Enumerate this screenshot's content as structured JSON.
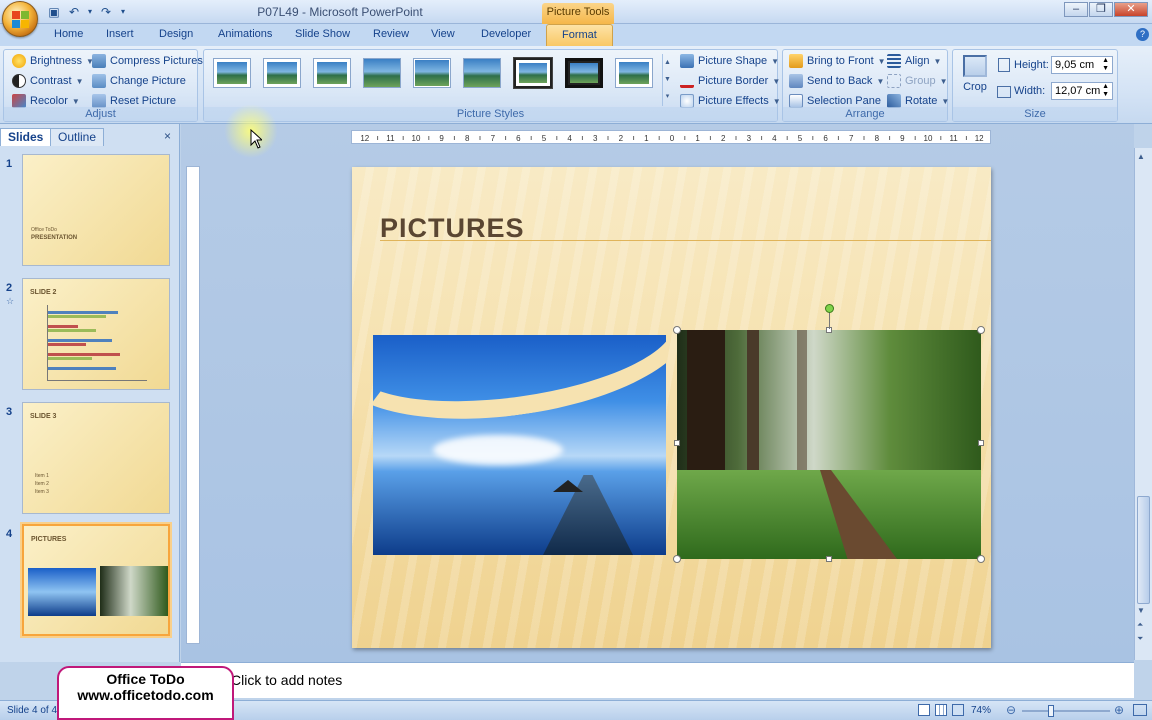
{
  "window": {
    "title": "P07L49 - Microsoft PowerPoint",
    "tool_context": "Picture Tools"
  },
  "tabs": [
    "Home",
    "Insert",
    "Design",
    "Animations",
    "Slide Show",
    "Review",
    "View",
    "Developer",
    "Format"
  ],
  "active_tab": "Format",
  "ribbon": {
    "adjust": {
      "label": "Adjust",
      "brightness": "Brightness",
      "contrast": "Contrast",
      "recolor": "Recolor",
      "compress": "Compress Pictures",
      "change": "Change Picture",
      "reset": "Reset Picture"
    },
    "styles": {
      "label": "Picture Styles",
      "shape": "Picture Shape",
      "border": "Picture Border",
      "effects": "Picture Effects"
    },
    "arrange": {
      "label": "Arrange",
      "front": "Bring to Front",
      "back": "Send to Back",
      "pane": "Selection Pane",
      "align": "Align",
      "group": "Group",
      "rotate": "Rotate"
    },
    "size": {
      "label": "Size",
      "crop": "Crop",
      "height_label": "Height:",
      "height_value": "9,05 cm",
      "width_label": "Width:",
      "width_value": "12,07 cm"
    }
  },
  "pane": {
    "slides_tab": "Slides",
    "outline_tab": "Outline",
    "slides": [
      {
        "num": "1",
        "title": "PRESENTATION",
        "subtitle": "Office ToDo"
      },
      {
        "num": "2",
        "title": "SLIDE 2"
      },
      {
        "num": "3",
        "title": "SLIDE 3",
        "items": [
          "Item 1",
          "Item 2",
          "Item 3"
        ]
      },
      {
        "num": "4",
        "title": "PICTURES"
      }
    ]
  },
  "ruler": {
    "ticks": [
      "12",
      "11",
      "10",
      "9",
      "8",
      "7",
      "6",
      "5",
      "4",
      "3",
      "2",
      "1",
      "0",
      "1",
      "2",
      "3",
      "4",
      "5",
      "6",
      "7",
      "8",
      "9",
      "10",
      "11",
      "12"
    ]
  },
  "slide": {
    "title": "PICTURES"
  },
  "notes": {
    "placeholder": "Click to add notes"
  },
  "status": {
    "slide_info": "Slide 4 of 4",
    "zoom": "74%"
  },
  "watermark": {
    "line1": "Office ToDo",
    "line2": "www.officetodo.com"
  },
  "colors": {
    "ribbon": "#d4e3f5",
    "active_tab": "#f9c865",
    "selection": "#f7a53c",
    "watermark_border": "#c0187a"
  }
}
